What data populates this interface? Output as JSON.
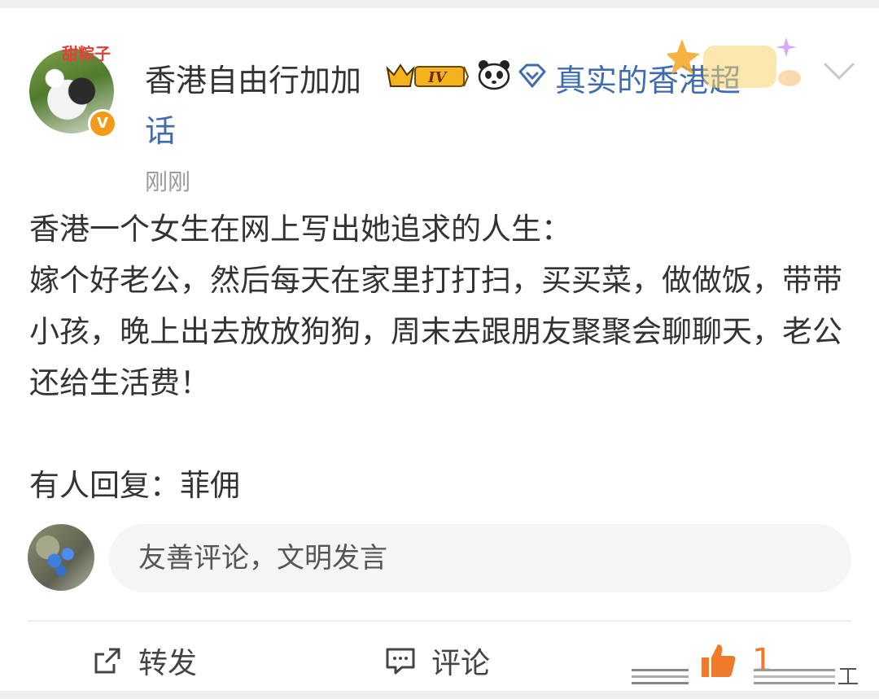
{
  "post": {
    "author": {
      "name": "香港自由行加加",
      "avatar_tag": "甜粽子",
      "verified_badge": "V",
      "level_badge": "IV"
    },
    "topic_line1": "真实的香港超",
    "topic_line2": "话",
    "time": "刚刚",
    "paragraphs": [
      "香港一个女生在网上写出她追求的人生：",
      "嫁个好老公，然后每天在家里打打扫，买买菜，做做饭，带带小孩，晚上出去放放狗狗，周末去跟朋友聚聚会聊聊天，老公还给生活费！",
      "",
      "有人回复：菲佣"
    ]
  },
  "comment_box": {
    "placeholder": "友善评论，文明发言"
  },
  "actions": {
    "repost_label": "转发",
    "comment_label": "评论",
    "like_count": "1"
  },
  "colors": {
    "text": "#333333",
    "link": "#3f6cae",
    "meta": "#999999",
    "like": "#f07a2c",
    "badge": "#f39a1b"
  },
  "icons": [
    "crown-level-icon",
    "panda-icon",
    "diamond-icon",
    "chevron-down-icon",
    "repost-icon",
    "comment-icon",
    "thumbs-up-icon"
  ]
}
